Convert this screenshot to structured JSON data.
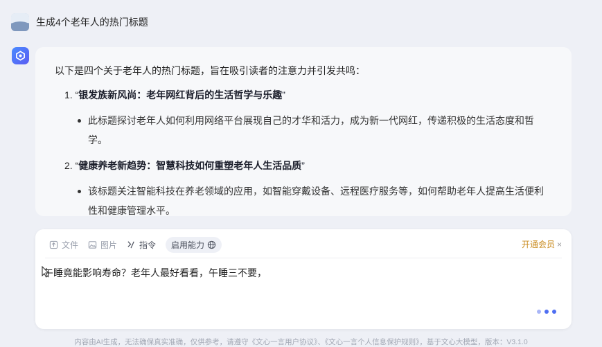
{
  "user": {
    "prompt": "生成4个老年人的热门标题"
  },
  "answer": {
    "intro": "以下是四个关于老年人的热门标题，旨在吸引读者的注意力并引发共鸣：",
    "items": [
      {
        "num": "1. “",
        "title": "银发族新风尚：老年网红背后的生活哲学与乐趣",
        "close": "”",
        "desc": "此标题探讨老年人如何利用网络平台展现自己的才华和活力，成为新一代网红，传递积极的生活态度和哲学。"
      },
      {
        "num": "2. “",
        "title": "健康养老新趋势：智慧科技如何重塑老年人生活品质",
        "close": "”",
        "desc": "该标题关注智能科技在养老领域的应用，如智能穿戴设备、远程医疗服务等，如何帮助老年人提高生活便利性和健康管理水平。"
      }
    ]
  },
  "composer": {
    "tools": {
      "file": "文件",
      "image": "图片",
      "command": "指令",
      "capability": "启用能力"
    },
    "vip": "开通会员",
    "vip_close": "×",
    "text": "午睡竟能影响寿命？老年人最好看看，午睡三不要，"
  },
  "footer": "内容由AI生成，无法确保真实准确，仅供参考，请遵守《文心一言用户协议》、《文心一言个人信息保护规则》，基于文心大模型，版本：V3.1.0",
  "colors": {
    "accent": "#4e6ef2",
    "vip": "#c98b1e",
    "background": "#eef0f6"
  },
  "icons": {
    "file": "file-icon",
    "image": "image-icon",
    "command": "command-icon",
    "globe": "globe-icon",
    "bot": "bot-logo-icon",
    "cursor": "mouse-cursor-icon"
  }
}
